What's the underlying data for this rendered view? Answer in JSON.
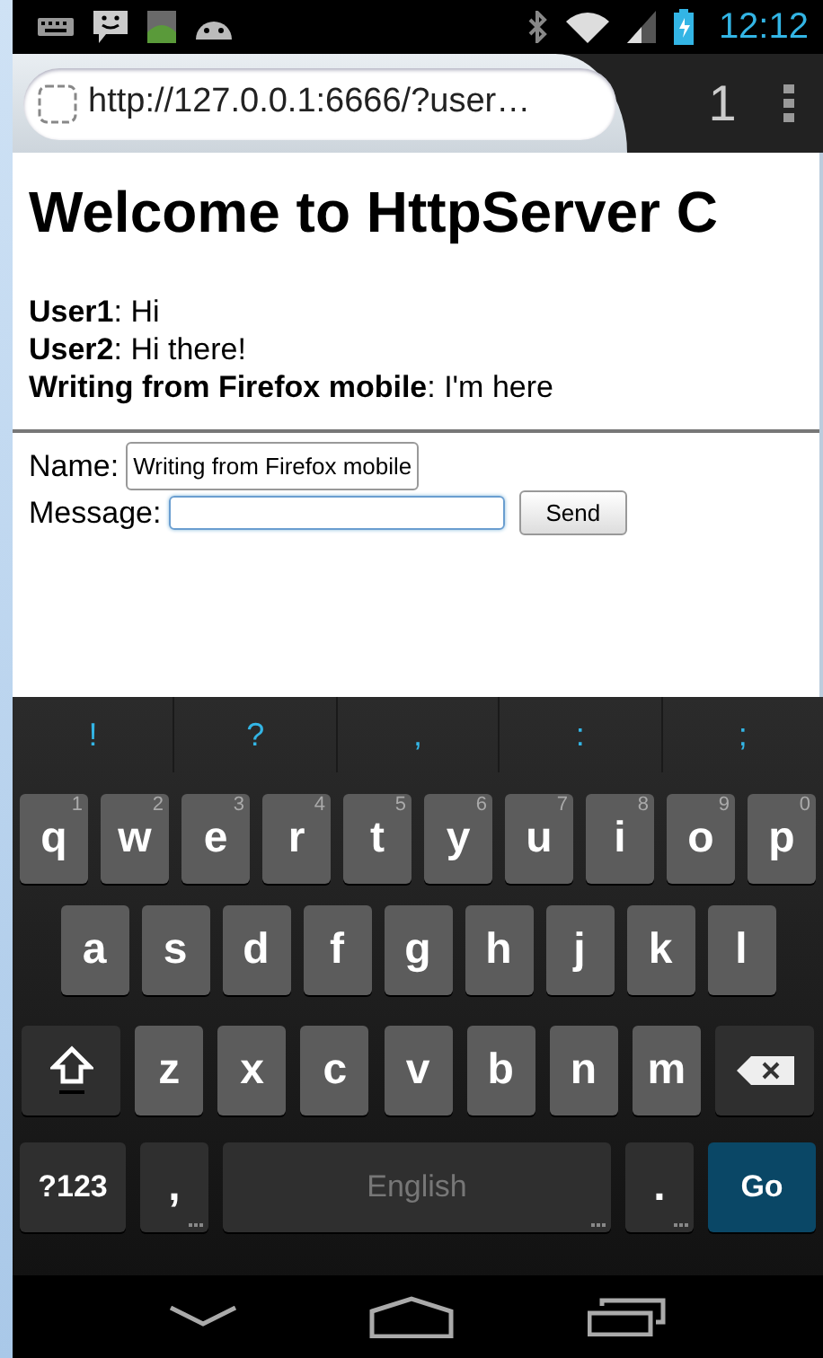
{
  "status_bar": {
    "time": "12:12"
  },
  "browser": {
    "url": "http://127.0.0.1:6666/?user…",
    "tab_count": "1"
  },
  "page": {
    "heading": "Welcome to HttpServer C",
    "messages": [
      {
        "text": "**User1**: Hi"
      },
      {
        "text": "**User2**: Hi there!"
      },
      {
        "text": "**Writing from Firefox mobile**: I'm here"
      }
    ],
    "form": {
      "name_label": "Name:",
      "name_value": "Writing from Firefox mobile",
      "message_label": "Message:",
      "message_focused": true,
      "send_button": "Send"
    }
  },
  "keyboard": {
    "suggestions": [
      "!",
      "?",
      ",",
      ":",
      ";"
    ],
    "key_rows": [
      {
        "keys": [
          {
            "kind": "letter",
            "label": "q",
            "hint": "1"
          },
          {
            "kind": "letter",
            "label": "w",
            "hint": "2"
          },
          {
            "kind": "letter",
            "label": "e",
            "hint": "3"
          },
          {
            "kind": "letter",
            "label": "r",
            "hint": "4"
          },
          {
            "kind": "letter",
            "label": "t",
            "hint": "5"
          },
          {
            "kind": "letter",
            "label": "y",
            "hint": "6"
          },
          {
            "kind": "letter",
            "label": "u",
            "hint": "7"
          },
          {
            "kind": "letter",
            "label": "i",
            "hint": "8"
          },
          {
            "kind": "letter",
            "label": "o",
            "hint": "9"
          },
          {
            "kind": "letter",
            "label": "p",
            "hint": "0"
          }
        ]
      },
      {
        "keys": [
          {
            "kind": "letter",
            "label": "a"
          },
          {
            "kind": "letter",
            "label": "s"
          },
          {
            "kind": "letter",
            "label": "d"
          },
          {
            "kind": "letter",
            "label": "f"
          },
          {
            "kind": "letter",
            "label": "g"
          },
          {
            "kind": "letter",
            "label": "h"
          },
          {
            "kind": "letter",
            "label": "j"
          },
          {
            "kind": "letter",
            "label": "k"
          },
          {
            "kind": "letter",
            "label": "l"
          }
        ]
      },
      {
        "keys": [
          {
            "kind": "shift"
          },
          {
            "kind": "letter",
            "label": "z"
          },
          {
            "kind": "letter",
            "label": "x"
          },
          {
            "kind": "letter",
            "label": "c"
          },
          {
            "kind": "letter",
            "label": "v"
          },
          {
            "kind": "letter",
            "label": "b"
          },
          {
            "kind": "letter",
            "label": "n"
          },
          {
            "kind": "letter",
            "label": "m"
          },
          {
            "kind": "backspace"
          }
        ]
      },
      {
        "keys": [
          {
            "kind": "symbols",
            "label": "?123"
          },
          {
            "kind": "punct",
            "label": ",",
            "more": true
          },
          {
            "kind": "space",
            "label": "English",
            "more": true
          },
          {
            "kind": "punct",
            "label": ".",
            "more": true
          },
          {
            "kind": "go",
            "label": "Go"
          }
        ]
      }
    ]
  }
}
